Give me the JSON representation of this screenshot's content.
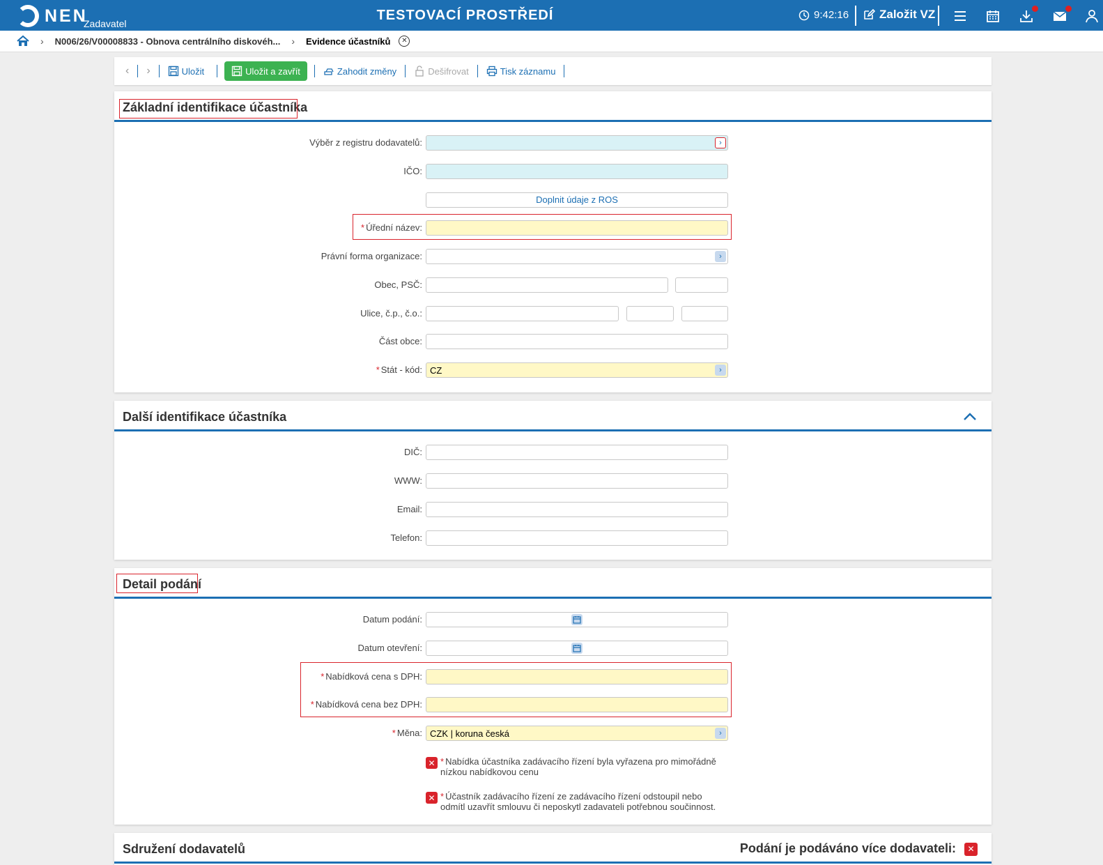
{
  "header": {
    "logo_text": "NEN",
    "logo_sub": "Zadavatel",
    "env_title": "TESTOVACÍ PROSTŘEDÍ",
    "clock": "9:42:16",
    "create_label": "Založit VZ"
  },
  "breadcrumb": {
    "items": [
      "N006/26/V00008833 - Obnova centrálního diskovéh...",
      "Evidence účastníků"
    ]
  },
  "toolbar": {
    "save": "Uložit",
    "save_close": "Uložit a zavřít",
    "discard": "Zahodit změny",
    "decrypt": "Dešifrovat",
    "print": "Tisk záznamu"
  },
  "section_basic": {
    "title": "Základní identifikace účastníka",
    "registry_label": "Výběr z registru dodavatelů:",
    "ico_label": "IČO:",
    "ros_button": "Doplnit údaje z ROS",
    "official_name_label": "Úřední název:",
    "legal_form_label": "Právní forma organizace:",
    "city_label": "Obec, PSČ:",
    "street_label": "Ulice, č.p., č.o.:",
    "district_label": "Část obce:",
    "country_label": "Stát - kód:",
    "country_value": "CZ"
  },
  "section_more": {
    "title": "Další identifikace účastníka",
    "dic_label": "DIČ:",
    "www_label": "WWW:",
    "email_label": "Email:",
    "phone_label": "Telefon:"
  },
  "section_detail": {
    "title": "Detail podání",
    "date_submit_label": "Datum podání:",
    "date_open_label": "Datum otevření:",
    "price_vat_label": "Nabídková cena s DPH:",
    "price_novat_label": "Nabídková cena bez DPH:",
    "currency_label": "Měna:",
    "currency_value": "CZK | koruna česká",
    "check1": "Nabídka účastníka zadávacího řízení byla vyřazena pro mimořádně nízkou nabídkovou cenu",
    "check2": "Účastník zadávacího řízení ze zadávacího řízení odstoupil nebo odmítl uzavřít smlouvu či neposkytl zadavateli potřebnou součinnost."
  },
  "section_assoc": {
    "title": "Sdružení dodavatelů",
    "multi_label": "Podání je podáváno více dodavateli:"
  },
  "colors": {
    "brand": "#1c6fb3",
    "primary_button": "#3cb251",
    "required": "#d9232b",
    "required_field": "#fff8c6",
    "lookup_field": "#d9f2f6"
  }
}
